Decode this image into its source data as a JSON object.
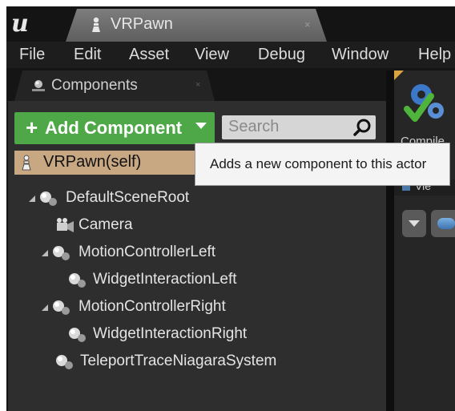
{
  "title_bar": {
    "app_logo": "ue-logo",
    "document_tab": "VRPawn",
    "close_symbol": "×"
  },
  "menu": [
    "File",
    "Edit",
    "Asset",
    "View",
    "Debug",
    "Window",
    "Help"
  ],
  "components_panel": {
    "tab_label": "Components",
    "close_symbol": "×",
    "add_button": {
      "plus": "+",
      "label": "Add Component"
    },
    "search": {
      "placeholder": "Search"
    },
    "self_item": "VRPawn(self)",
    "tree": [
      {
        "label": "DefaultSceneRoot",
        "icon": "scene-component-icon",
        "expanded": true
      },
      {
        "label": "Camera",
        "icon": "camera-icon",
        "expanded": false
      },
      {
        "label": "MotionControllerLeft",
        "icon": "scene-component-icon",
        "expanded": true
      },
      {
        "label": "WidgetInteractionLeft",
        "icon": "scene-component-icon",
        "expanded": false
      },
      {
        "label": "MotionControllerRight",
        "icon": "scene-component-icon",
        "expanded": true
      },
      {
        "label": "WidgetInteractionRight",
        "icon": "scene-component-icon",
        "expanded": false
      },
      {
        "label": "TeleportTraceNiagaraSystem",
        "icon": "scene-component-icon",
        "expanded": false
      }
    ]
  },
  "tooltip": "Adds a new component to this actor",
  "toolbar": {
    "compile_label_partial": "Compile",
    "viewport_label_partial": "Vie"
  },
  "colors": {
    "add_button": "#4fa847",
    "selected_row": "#c8a883",
    "panel_bg": "#2e2e2e",
    "title_bg": "#141414"
  }
}
